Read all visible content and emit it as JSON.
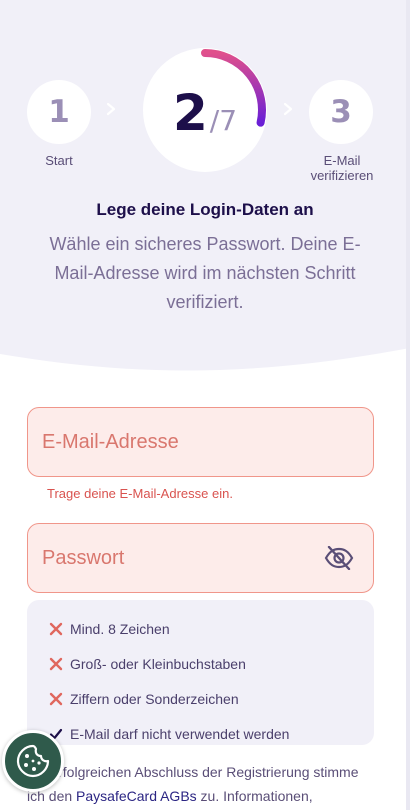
{
  "progress": {
    "previous_step": {
      "number": "1",
      "label": "Start"
    },
    "current_step": {
      "number": "2",
      "separator": "/",
      "total": "7",
      "fraction_complete": 0.2857
    },
    "next_step": {
      "number": "3",
      "label": "E-Mail verifizieren"
    },
    "colors": {
      "ring_start": "#e0508c",
      "ring_end": "#6a1fd6"
    }
  },
  "header": {
    "title": "Lege deine Login-Daten an",
    "subtitle": "Wähle ein sicheres Passwort. Deine E-Mail-Adresse wird im nächsten Schritt verifiziert."
  },
  "form": {
    "email": {
      "placeholder": "E-Mail-Adresse",
      "value": "",
      "error": "Trage deine E-Mail-Adresse ein."
    },
    "password": {
      "placeholder": "Passwort",
      "value": "",
      "toggle_icon": "eye-off-icon"
    }
  },
  "password_rules": [
    {
      "text": "Mind. 8 Zeichen",
      "status": "failed"
    },
    {
      "text": "Groß- oder Kleinbuchstaben",
      "status": "failed"
    },
    {
      "text": "Ziffern oder Sonderzeichen",
      "status": "failed"
    },
    {
      "text": "E-Mail darf nicht verwendet werden",
      "status": "passed"
    }
  ],
  "footer": {
    "text_before": "em erfolgreichen Abschluss der Registrierung stimme ich den ",
    "link": "PaysafeCard AGBs",
    "text_after": " zu. Informationen,"
  },
  "cookie_button": {
    "icon": "cookie-icon"
  },
  "colors": {
    "error": "#d9534f",
    "field_bg": "#fdecea",
    "field_border": "#f0968a",
    "navy": "#1d0f4a"
  }
}
